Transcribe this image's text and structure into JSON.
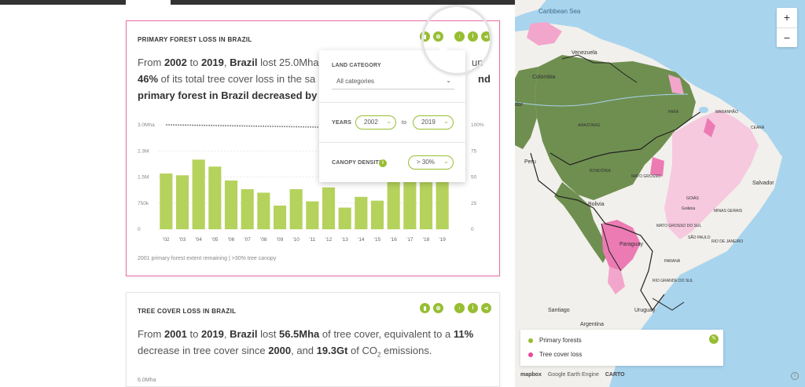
{
  "widget1": {
    "title": "PRIMARY FOREST LOSS IN BRAZIL",
    "sentence": {
      "p1": "From ",
      "year_start": "2002",
      "p2": " to ",
      "year_end": "2019",
      "p3": ", ",
      "country": "Brazil",
      "p4": " lost 25.0Mha ",
      "tail1": "c",
      "tail2": "up",
      "pct": "46%",
      "p5": " of its total tree cover loss in the sa",
      "tail3": "nd",
      "p6": "primary forest in Brazil decreased by 7."
    },
    "y_left_ticks": [
      "3.0Mha",
      "2.3M",
      "1.5M",
      "750k",
      "0"
    ],
    "y_right_ticks": [
      "100%",
      "75",
      "50",
      "25",
      "0"
    ],
    "footnote": "2001 primary forest extent remaining | >30% tree canopy",
    "colors": {
      "bar": "#b5d25c",
      "accent_border": "#e96fa6",
      "tool": "#97be32"
    }
  },
  "chart_data": {
    "type": "bar",
    "categories": [
      "'02",
      "'03",
      "'04",
      "'05",
      "'06",
      "'07",
      "'08",
      "'09",
      "'10",
      "'11",
      "'12",
      "'13",
      "'14",
      "'15",
      "'16",
      "'17",
      "'18",
      "'19"
    ],
    "values": [
      1.6,
      1.55,
      2.0,
      1.8,
      1.4,
      1.15,
      1.05,
      0.68,
      1.15,
      0.8,
      1.2,
      0.62,
      0.93,
      0.82,
      2.65,
      1.95,
      1.35,
      1.45
    ],
    "ylim": [
      0,
      3.0
    ],
    "ylabel": "Mha",
    "line_series": {
      "name": "2001 primary forest extent remaining",
      "start_pct": 100,
      "end_pct": 96
    }
  },
  "settings": {
    "land_label": "LAND CATEGORY",
    "land_value": "All categories",
    "years_label": "YEARS",
    "year_from": "2002",
    "to_label": "to",
    "year_to": "2019",
    "canopy_label": "CANOPY DENSITY",
    "canopy_value": "> 30%"
  },
  "widget2": {
    "title": "TREE COVER LOSS IN BRAZIL",
    "sentence": {
      "p1": "From ",
      "year_start": "2001",
      "p2": " to ",
      "year_end": "2019",
      "p3": ", ",
      "country": "Brazil",
      "p4": " lost ",
      "amount": "56.5Mha",
      "p5": " of tree cover, equivalent to a ",
      "pct": "11%",
      "p6": " decrease in tree cover since ",
      "year_since": "2000",
      "p7": ", and ",
      "emissions": "19.3Gt",
      "p8": " of CO",
      "sub": "2",
      "p9": " emissions."
    },
    "y_top_tick": "6.0Mha"
  },
  "map": {
    "labels": {
      "caribbean": "Caribbean Sea",
      "venezuela": "Venezuela",
      "colombia": "Colombia",
      "peru": "Peru",
      "bolivia": "Bolivia",
      "paraguay": "Paraguay",
      "uruguay": "Uruguay",
      "argentina": "Argentina",
      "santiago": "Santiago",
      "ecuador": "dor",
      "amazonas": "AMAZONAS",
      "para": "PARÁ",
      "ceara": "CEARÁ",
      "salvador": "Salvador",
      "goias": "GOIÁS",
      "goiania": "Goiânia",
      "minas": "MINAS GERAIS",
      "rio": "RIO DE JANEIRO",
      "sao_paulo": "SÃO PAULO",
      "parana": "PARANÁ",
      "rgs": "RIO GRANDE DO SUL",
      "mato_grosso": "MATO GROSSO",
      "mgs": "MATO GROSSO DO SUL",
      "rondonia": "RONDÔNIA",
      "maranhao": "MARANHÃO"
    },
    "zoom_in": "+",
    "zoom_out": "−",
    "legend": [
      {
        "label": "Primary forests",
        "color": "#97be32"
      },
      {
        "label": "Tree cover loss",
        "color": "#e8479b"
      }
    ],
    "attribution": {
      "mapbox": "mapbox",
      "google": "Google Earth Engine",
      "carto": "CARTO"
    }
  }
}
